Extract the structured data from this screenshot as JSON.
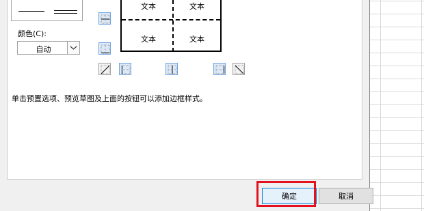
{
  "dialog": {
    "color_label": "颜色(C):",
    "color_value": "自动",
    "hint": "单击预置选项、预览草图及上面的按钮可以添加边框样式。",
    "ok_label": "确定",
    "cancel_label": "取消"
  },
  "preview": {
    "cells": [
      "文本",
      "文本",
      "文本",
      "文本"
    ]
  },
  "icons": {
    "left": [
      "border-horizontal-inner-icon",
      "border-bottom-icon"
    ],
    "bottom": [
      "diagonal-up-icon",
      "border-left-icon",
      "border-vertical-inner-icon",
      "border-right-icon",
      "diagonal-down-icon"
    ]
  },
  "colors": {
    "highlight": "#e3111f",
    "button_selected": "#dbe8f7",
    "button_selected_border": "#6ea3e0"
  }
}
